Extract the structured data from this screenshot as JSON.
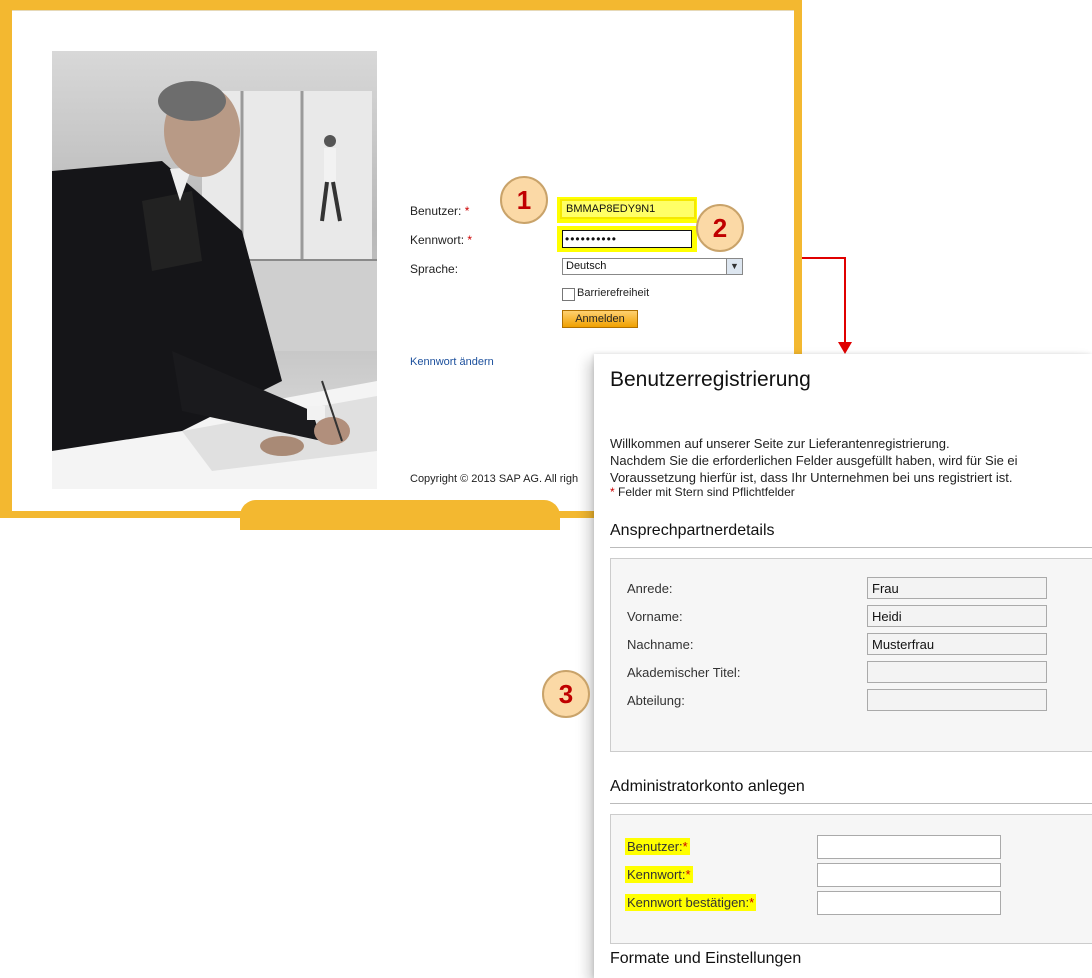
{
  "login": {
    "user_label": "Benutzer:",
    "password_label": "Kennwort:",
    "language_label": "Sprache:",
    "required_mark": "*",
    "user_value": "BMMAP8EDY9N1",
    "password_value": "••••••••••",
    "language_value": "Deutsch",
    "accessibility_label": "Barrierefreiheit",
    "login_button": "Anmelden",
    "change_password_link": "Kennwort ändern",
    "copyright": "Copyright © 2013 SAP AG. All righ"
  },
  "badges": [
    "1",
    "2",
    "3"
  ],
  "registration": {
    "title": "Benutzerregistrierung",
    "intro": [
      "Willkommen auf unserer Seite zur Lieferantenregistrierung.",
      "Nachdem Sie die erforderlichen Felder ausgefüllt haben, wird für Sie ei",
      "Voraussetzung hierfür ist, dass Ihr Unternehmen bei uns registriert ist."
    ],
    "required_note": "* Felder mit Stern sind Pflichtfelder",
    "contact_section": {
      "title": "Ansprechpartnerdetails",
      "fields": [
        {
          "label": "Anrede:",
          "value": "Frau"
        },
        {
          "label": "Vorname:",
          "value": "Heidi"
        },
        {
          "label": "Nachname:",
          "value": "Musterfrau"
        },
        {
          "label": "Akademischer Titel:",
          "value": ""
        },
        {
          "label": "Abteilung:",
          "value": ""
        }
      ]
    },
    "admin_section": {
      "title": "Administratorkonto anlegen",
      "fields": [
        {
          "label": "Benutzer:",
          "required": "*"
        },
        {
          "label": "Kennwort:",
          "required": "*"
        },
        {
          "label": "Kennwort bestätigen:",
          "required": "*"
        }
      ]
    },
    "formats_section": {
      "title": "Formate und Einstellungen"
    }
  },
  "colors": {
    "window_frame": "#f3b830",
    "highlight": "#ffff00",
    "badge_fill": "#fbd9a6",
    "badge_text": "#c00000",
    "connector": "#e00000",
    "required": "#cc0000"
  }
}
